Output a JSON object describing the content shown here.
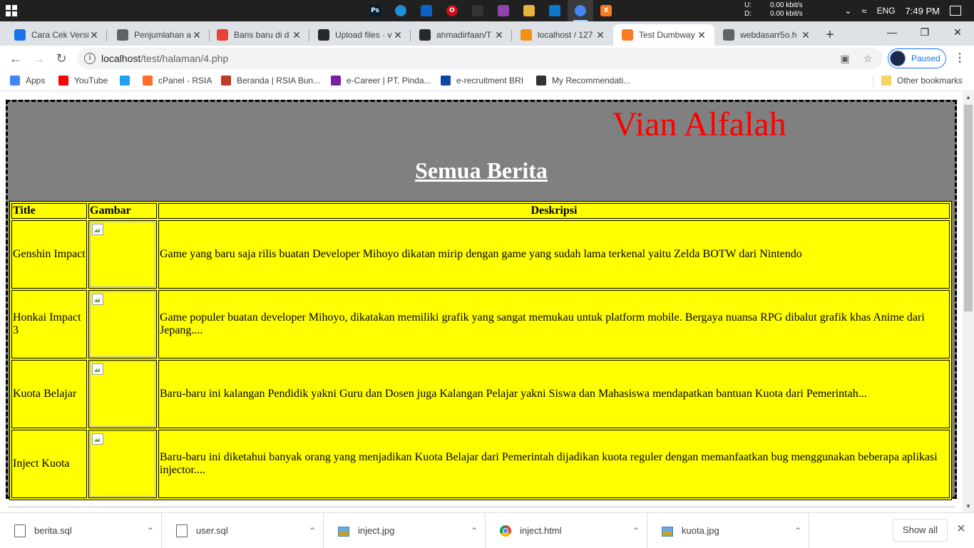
{
  "taskbar": {
    "net_up_label": "U:",
    "net_up_value": "0.00 kbit/s",
    "net_down_label": "D:",
    "net_down_value": "0.00 kbit/s",
    "language": "ENG",
    "time": "7:49 PM",
    "apps": [
      {
        "name": "photoshop",
        "glyph": "Ps",
        "color": "#001e36"
      },
      {
        "name": "edge",
        "glyph": "",
        "color": "#1f8fd6"
      },
      {
        "name": "mail",
        "glyph": "",
        "color": "#0a64c8"
      },
      {
        "name": "opera",
        "glyph": "O",
        "color": "#cc0f16"
      },
      {
        "name": "inkscape",
        "glyph": "",
        "color": "#333333"
      },
      {
        "name": "paint",
        "glyph": "",
        "color": "#8e44ad"
      },
      {
        "name": "file-explorer",
        "glyph": "",
        "color": "#e8b73a"
      },
      {
        "name": "vscode",
        "glyph": "",
        "color": "#0a7acc"
      },
      {
        "name": "chrome",
        "glyph": "",
        "color": "#4285f4"
      },
      {
        "name": "xampp",
        "glyph": "X",
        "color": "#fb7a24"
      }
    ]
  },
  "tabs": [
    {
      "label": "Cara Cek Versi",
      "favicon_color": "#1a73e8",
      "active": false
    },
    {
      "label": "Penjumlahan a",
      "favicon_color": "#5f6368",
      "active": false
    },
    {
      "label": "Baris baru di d",
      "favicon_color": "#e94235",
      "active": false
    },
    {
      "label": "Upload files · v",
      "favicon_color": "#24292e",
      "active": false
    },
    {
      "label": "ahmadirfaan/T",
      "favicon_color": "#24292e",
      "active": false
    },
    {
      "label": "localhost / 127",
      "favicon_color": "#f29111",
      "active": false
    },
    {
      "label": "Test Dumbway",
      "favicon_color": "#fb7a24",
      "active": true
    },
    {
      "label": "webdasarr5o.h",
      "favicon_color": "#5f6368",
      "active": false
    }
  ],
  "toolbar": {
    "url_host": "localhost",
    "url_path": "/test/halaman/4.php",
    "profile_label": "Paused"
  },
  "bookmarks": [
    {
      "label": "Apps",
      "color": "#4285f4"
    },
    {
      "label": "YouTube",
      "color": "#ff0000"
    },
    {
      "label": "",
      "color": "#1da1f2"
    },
    {
      "label": "cPanel - RSIA",
      "color": "#ff6c2c"
    },
    {
      "label": "Beranda | RSIA Bun...",
      "color": "#c0392b"
    },
    {
      "label": "e-Career | PT. Pinda...",
      "color": "#7b1fa2"
    },
    {
      "label": "e-recruitment BRI",
      "color": "#0d47a1"
    },
    {
      "label": "My Recommendati...",
      "color": "#333333"
    }
  ],
  "other_bookmarks": "Other bookmarks",
  "page": {
    "brand": "Vian Alfalah",
    "heading": "Semua Berita",
    "table": {
      "headers": [
        "Title",
        "Gambar",
        "Deskripsi"
      ],
      "rows": [
        {
          "title": "Genshin Impact",
          "description": "Game yang baru saja rilis buatan Developer Mihoyo dikatan mirip dengan game yang sudah lama terkenal yaitu Zelda BOTW dari Nintendo"
        },
        {
          "title": "Honkai Impact 3",
          "description": "Game populer buatan developer Mihoyo, dikatakan memiliki grafik yang sangat memukau untuk platform mobile. Bergaya nuansa RPG dibalut grafik khas Anime dari Jepang...."
        },
        {
          "title": "Kuota Belajar",
          "description": "Baru-baru ini kalangan Pendidik yakni Guru dan Dosen juga Kalangan Pelajar yakni Siswa dan Mahasiswa mendapatkan bantuan Kuota dari Pemerintah..."
        },
        {
          "title": "Inject Kuota",
          "description": "Baru-baru ini diketahui banyak orang yang menjadikan Kuota Belajar dari Pemerintah dijadikan kuota reguler dengan memanfaatkan bug menggunakan beberapa aplikasi injector...."
        }
      ]
    }
  },
  "downloads": {
    "items": [
      {
        "name": "berita.sql",
        "icon": "file-icon"
      },
      {
        "name": "user.sql",
        "icon": "file-icon"
      },
      {
        "name": "inject.jpg",
        "icon": "image-icon"
      },
      {
        "name": "inject.html",
        "icon": "chrome-icon"
      },
      {
        "name": "kuota.jpg",
        "icon": "image-icon"
      }
    ],
    "show_all": "Show all"
  }
}
